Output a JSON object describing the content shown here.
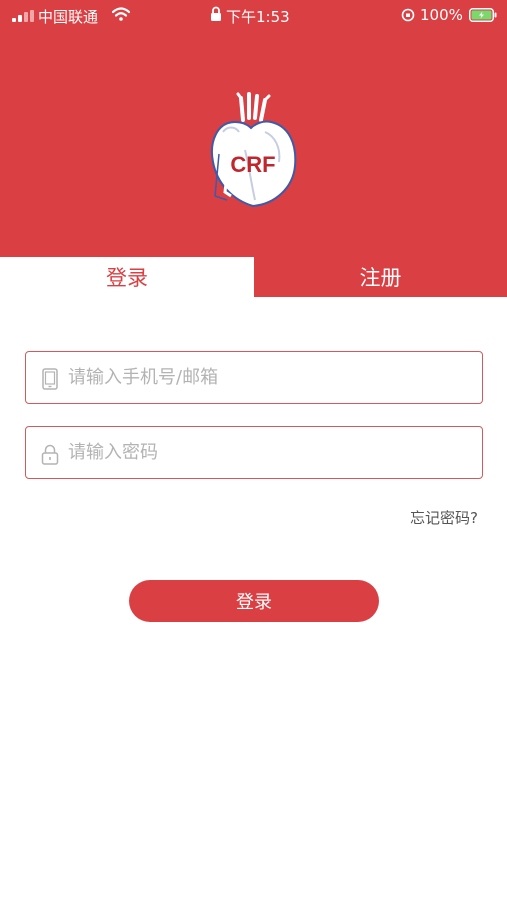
{
  "status_bar": {
    "carrier": "中国联通",
    "time": "下午1:53",
    "battery_percent": "100%"
  },
  "logo": {
    "text": "CRF",
    "icon": "heart-icon"
  },
  "tabs": {
    "login": "登录",
    "register": "注册",
    "active": "login"
  },
  "form": {
    "phone_placeholder": "请输入手机号/邮箱",
    "phone_value": "",
    "password_placeholder": "请输入密码",
    "password_value": "",
    "forgot_label": "忘记密码?",
    "submit_label": "登录"
  },
  "colors": {
    "brand": "#d93f43",
    "field_border": "#d05a5c",
    "placeholder": "#b3b3b3"
  }
}
